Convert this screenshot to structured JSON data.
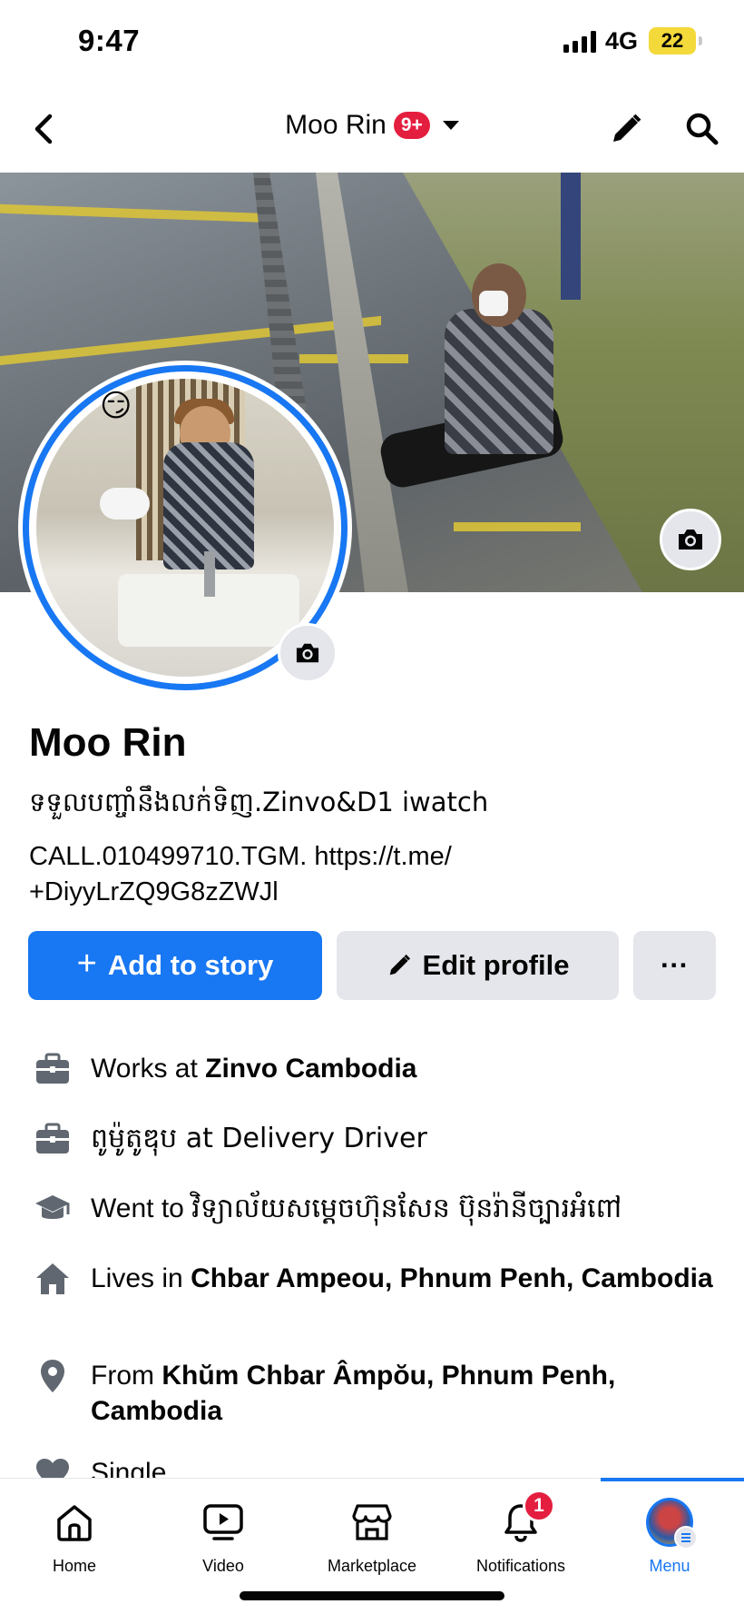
{
  "status_bar": {
    "time": "9:47",
    "network": "4G",
    "battery": "22"
  },
  "header": {
    "title": "Moo Rin",
    "badge": "9+",
    "icons": [
      "back-chevron-icon",
      "pencil-icon",
      "search-icon"
    ]
  },
  "profile": {
    "name": "Moo Rin",
    "bio_line1": "ទទួលបញ្ចាំនឹងលក់ទិញ.Zinvo&D1 iwatch",
    "bio_line2": "CALL.010499710.TGM. https://t.me/ +DiyyLrZQ9G8zZWJl",
    "emoji": "😏"
  },
  "actions": {
    "add_story": "Add to story",
    "edit_profile": "Edit profile",
    "more": "···"
  },
  "details": [
    {
      "icon": "briefcase-icon",
      "prefix": "Works at ",
      "bold": "Zinvo Cambodia",
      "suffix": ""
    },
    {
      "icon": "briefcase-icon",
      "prefix": "ពូម៉ូតូឌុប at Delivery Driver",
      "bold": "",
      "suffix": ""
    },
    {
      "icon": "graduation-cap-icon",
      "prefix": "Went to ",
      "bold": "",
      "suffix": "វិទ្យាល័យសម្តេចហ៊ុនសែន ប៊ុនរ៉ានីច្បារអំពៅ"
    },
    {
      "icon": "house-icon",
      "prefix": "Lives in ",
      "bold": "Chbar Ampeou, Phnum Penh, Cambodia",
      "suffix": ""
    },
    {
      "icon": "location-pin-icon",
      "prefix": "From ",
      "bold": "Khŭm Chbar Âmpŏu, Phnum Penh, Cambodia",
      "suffix": ""
    },
    {
      "icon": "heart-icon",
      "prefix": "Single",
      "bold": "",
      "suffix": ""
    }
  ],
  "tabs": [
    {
      "label": "Home",
      "icon": "home-icon"
    },
    {
      "label": "Video",
      "icon": "video-icon"
    },
    {
      "label": "Marketplace",
      "icon": "marketplace-icon"
    },
    {
      "label": "Notifications",
      "icon": "bell-icon",
      "badge": "1"
    },
    {
      "label": "Menu",
      "icon": "menu-avatar-icon",
      "active": true
    }
  ],
  "colors": {
    "accent": "#1877f2",
    "badge": "#e41e3f",
    "button_gray": "#e4e6eb"
  }
}
